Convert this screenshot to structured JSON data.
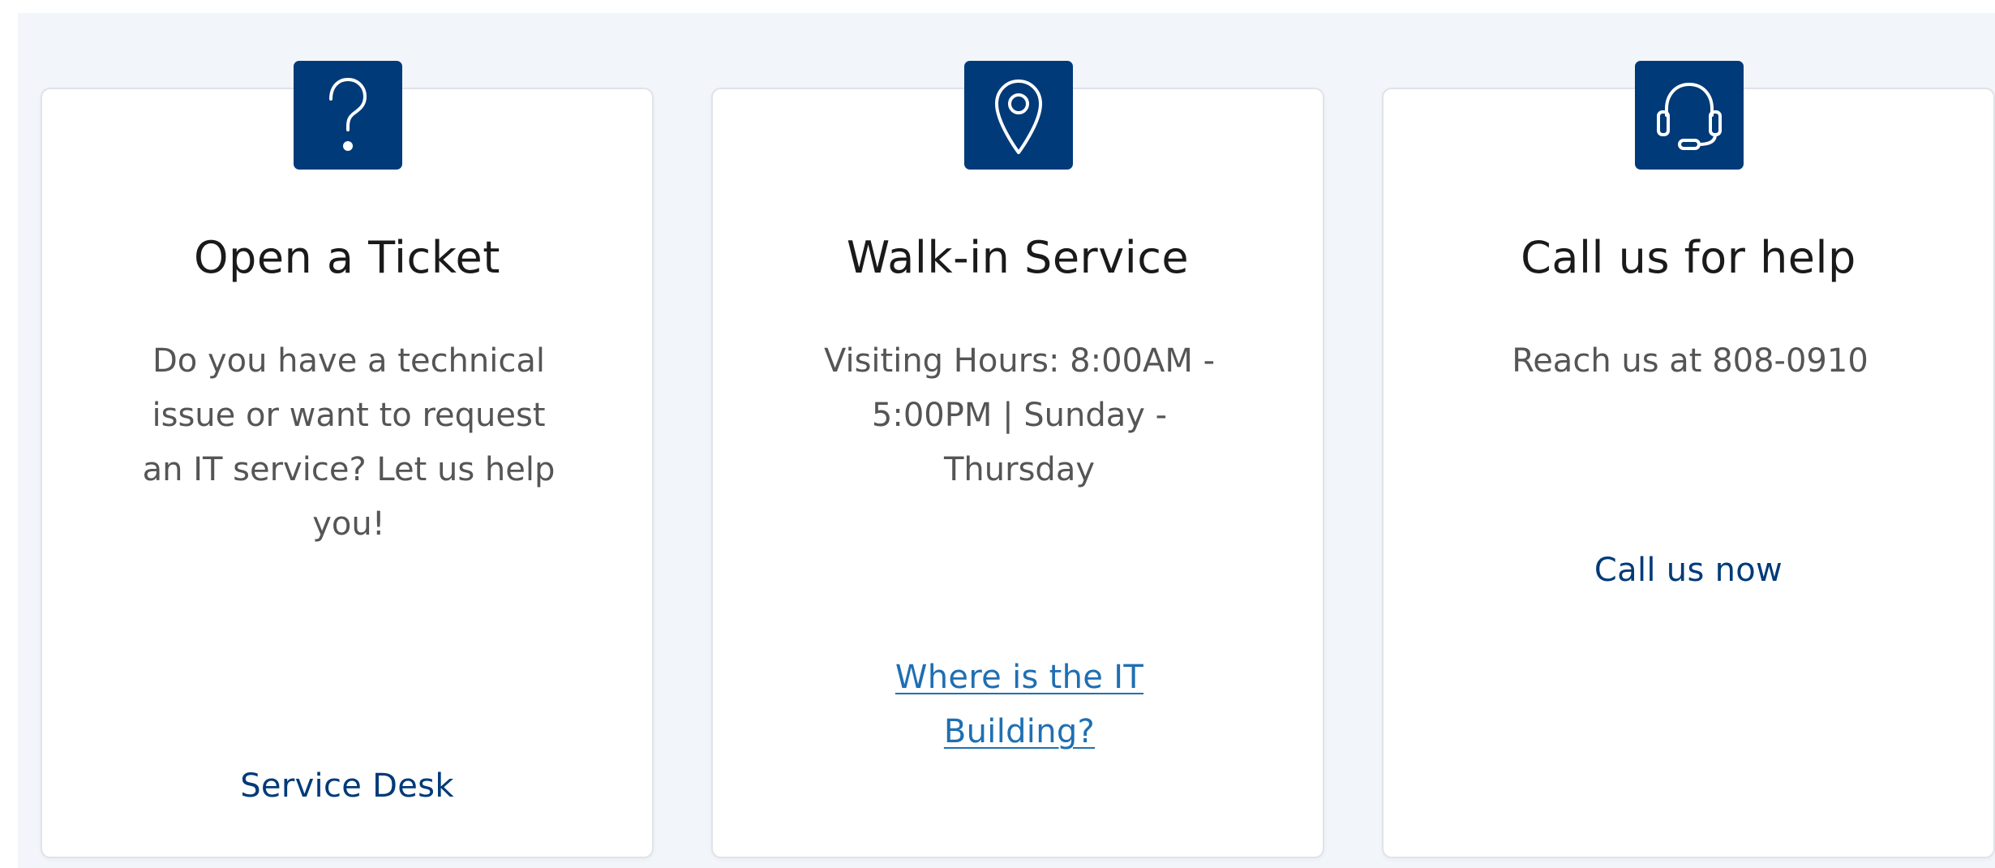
{
  "colors": {
    "accent": "#003a78",
    "link": "#1f6fb2",
    "background": "#f2f5f9",
    "card": "#ffffff"
  },
  "cards": [
    {
      "icon": "question-icon",
      "title": "Open a Ticket",
      "text": "Do you have a technical issue or want to request an IT service? Let us help you!",
      "link": "Service Desk"
    },
    {
      "icon": "location-pin-icon",
      "title": "Walk-in Service",
      "text": "Visiting Hours: 8:00AM - 5:00PM | Sunday - Thursday",
      "link": "Where is the IT Building?"
    },
    {
      "icon": "headset-icon",
      "title": "Call us for help",
      "text": "Reach us at 808-0910",
      "link": "Call us now"
    }
  ]
}
